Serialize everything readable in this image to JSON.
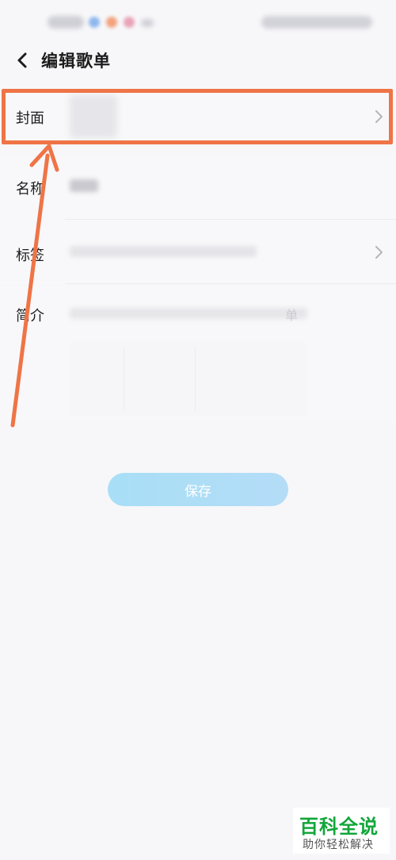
{
  "header": {
    "title": "编辑歌单"
  },
  "form": {
    "cover_label": "封面",
    "name_label": "名称",
    "tags_label": "标签",
    "intro_label": "简介",
    "intro_placeholder_tail": "单"
  },
  "actions": {
    "save_label": "保存"
  },
  "watermark": {
    "title": "百科全说",
    "subtitle": "助你轻松解决"
  },
  "colors": {
    "highlight": "#ef7446",
    "save_button": "#a8dff6",
    "watermark_green": "#12a63a"
  },
  "icons": {
    "back": "chevron-left-icon",
    "row_arrow": "chevron-right-icon"
  }
}
